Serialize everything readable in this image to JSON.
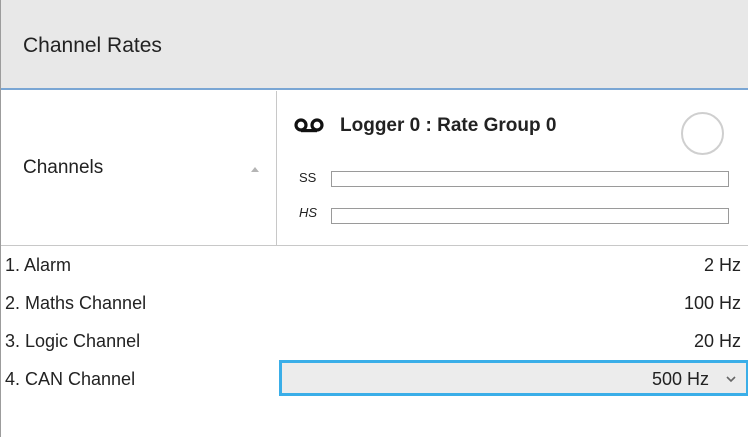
{
  "panel": {
    "title": "Channel Rates"
  },
  "header": {
    "channels_label": "Channels",
    "logger_title": "Logger 0 :  Rate Group 0",
    "ss_label": "SS",
    "hs_label": "HS",
    "ss_level": 0,
    "hs_level": 0
  },
  "rows": [
    {
      "name": "1. Alarm",
      "rate": "2 Hz"
    },
    {
      "name": "2. Maths Channel",
      "rate": "100 Hz"
    },
    {
      "name": "3. Logic Channel",
      "rate": "20 Hz"
    },
    {
      "name": "4. CAN Channel",
      "rate": "500 Hz"
    }
  ],
  "colors": {
    "accent": "#3aaee8",
    "header_rule": "#7aa6d4",
    "title_bg": "#e8e8e8"
  },
  "icons": {
    "logger": "cassette-tape-icon",
    "sort": "sort-ascending-icon",
    "status": "status-circle-icon",
    "dropdown": "chevron-down-icon"
  }
}
